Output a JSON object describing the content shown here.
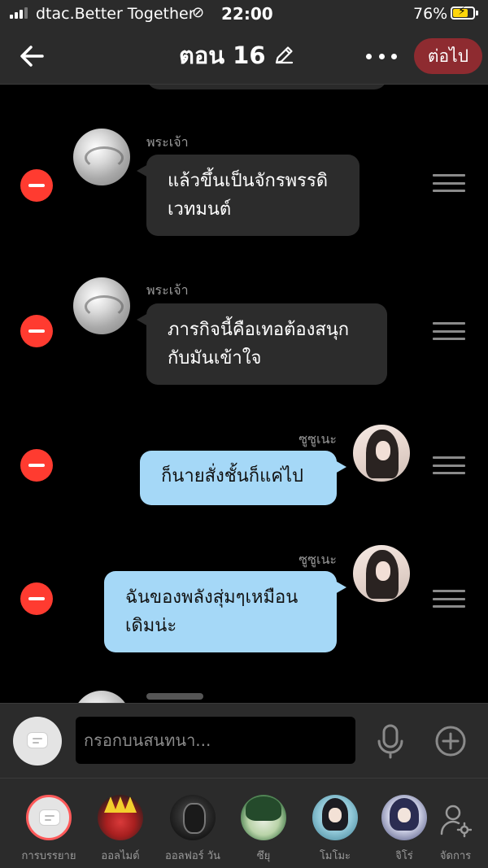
{
  "status_bar": {
    "carrier": "dtac.Better Together",
    "link_glyph": "⊘",
    "time": "22:00",
    "battery_percent": "76%",
    "battery_level": 0.76,
    "battery_color": "#ffd60a"
  },
  "header": {
    "title": "ตอน 16",
    "next_label": "ต่อไป",
    "back_icon": "arrow-left-icon",
    "edit_icon": "pencil-icon",
    "more_icon": "more-horizontal-icon",
    "next_color": "#8e2b30"
  },
  "messages": [
    {
      "sender": "พระเจ้า",
      "side": "left",
      "text_lines": [
        "แล้วขึ้นเป็นจักรพรรดิ",
        "เวทมนต์"
      ]
    },
    {
      "sender": "พระเจ้า",
      "side": "left",
      "text_lines": [
        "ภารกิจนี้คือเทอต้องสนุก",
        "กับมันเข้าใจ"
      ]
    },
    {
      "sender": "ซูซูเนะ",
      "side": "right",
      "text_lines": [
        "ก็นายสั่งชั้นก็แค่ไป"
      ]
    },
    {
      "sender": "ซูซูเนะ",
      "side": "right",
      "text_lines": [
        "ฉันของพลังสุ่มๆเหมือน",
        "เดิมน่ะ"
      ]
    }
  ],
  "colors": {
    "remove": "#ff3b30",
    "left_bubble": "#2c2c2c",
    "right_bubble": "#a5d8f7"
  },
  "composer": {
    "placeholder": "กรอกบนสนทนา...",
    "mic_icon": "microphone-icon",
    "add_icon": "plus-circle-icon"
  },
  "characters": [
    {
      "label": "การบรรยาย",
      "icon": "chat-box-icon"
    },
    {
      "label": "ออลไมต์"
    },
    {
      "label": "ออลฟอร์ วัน"
    },
    {
      "label": "ซึยุ"
    },
    {
      "label": "โมโมะ"
    },
    {
      "label": "จิโร่"
    }
  ],
  "manage": {
    "label": "จัดการ",
    "icon": "user-settings-icon"
  }
}
